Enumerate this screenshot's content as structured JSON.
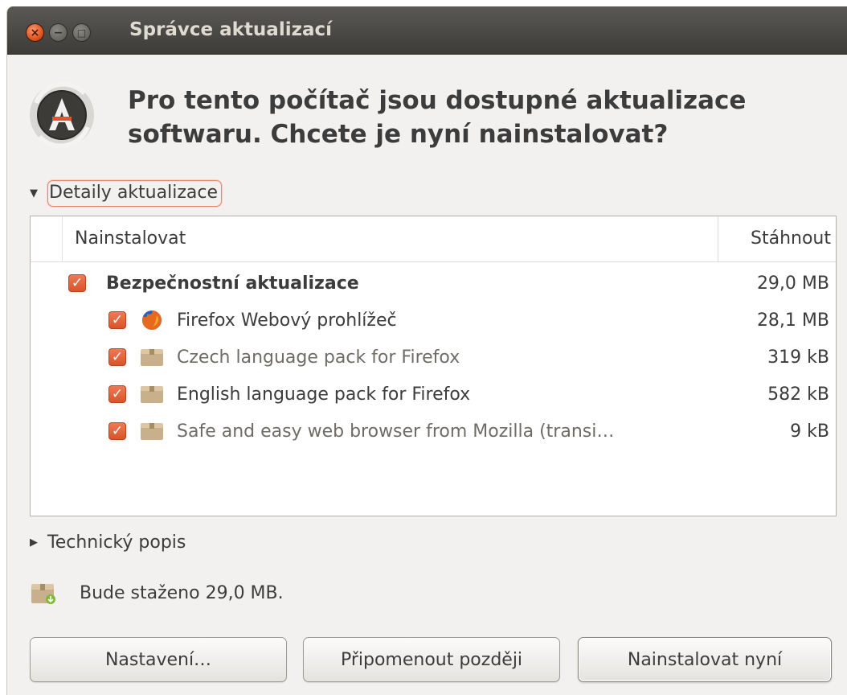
{
  "window": {
    "title": "Správce aktualizací",
    "close_glyph": "×",
    "minimize_glyph": "−",
    "maximize_glyph": "□"
  },
  "header": {
    "headline_line1": "Pro tento počítač jsou dostupné aktualizace",
    "headline_line2": "softwaru. Chcete je nyní nainstalovat?",
    "icon": "update-manager-icon"
  },
  "details_expander": {
    "label": "Detaily aktualizace",
    "expanded": true,
    "arrow": "▼"
  },
  "table": {
    "columns": {
      "install": "Nainstalovat",
      "download": "Stáhnout"
    },
    "group": {
      "label": "Bezpečnostní aktualizace",
      "size": "29,0 MB",
      "checked": true
    },
    "items": [
      {
        "label": "Firefox Webový prohlížeč",
        "size": "28,1 MB",
        "checked": true,
        "icon": "firefox-icon"
      },
      {
        "label": "Czech language pack for Firefox",
        "size": "319 kB",
        "checked": true,
        "icon": "package-icon"
      },
      {
        "label": "English language pack for Firefox",
        "size": "582 kB",
        "checked": true,
        "icon": "package-icon"
      },
      {
        "label": "Safe and easy web browser from Mozilla (transi…",
        "size": "9 kB",
        "checked": true,
        "icon": "package-icon"
      }
    ],
    "check_glyph": "✓"
  },
  "tech_expander": {
    "label": "Technický popis",
    "expanded": false,
    "arrow": "▶"
  },
  "status": {
    "text": "Bude staženo 29,0 MB.",
    "icon": "download-package-icon"
  },
  "buttons": {
    "settings": "Nastavení…",
    "remind_later": "Připomenout později",
    "install_now": "Nainstalovat nyní"
  },
  "colors": {
    "accent": "#dd5a2f",
    "titlebar": "#3c3b37",
    "background": "#f2f1f0"
  }
}
